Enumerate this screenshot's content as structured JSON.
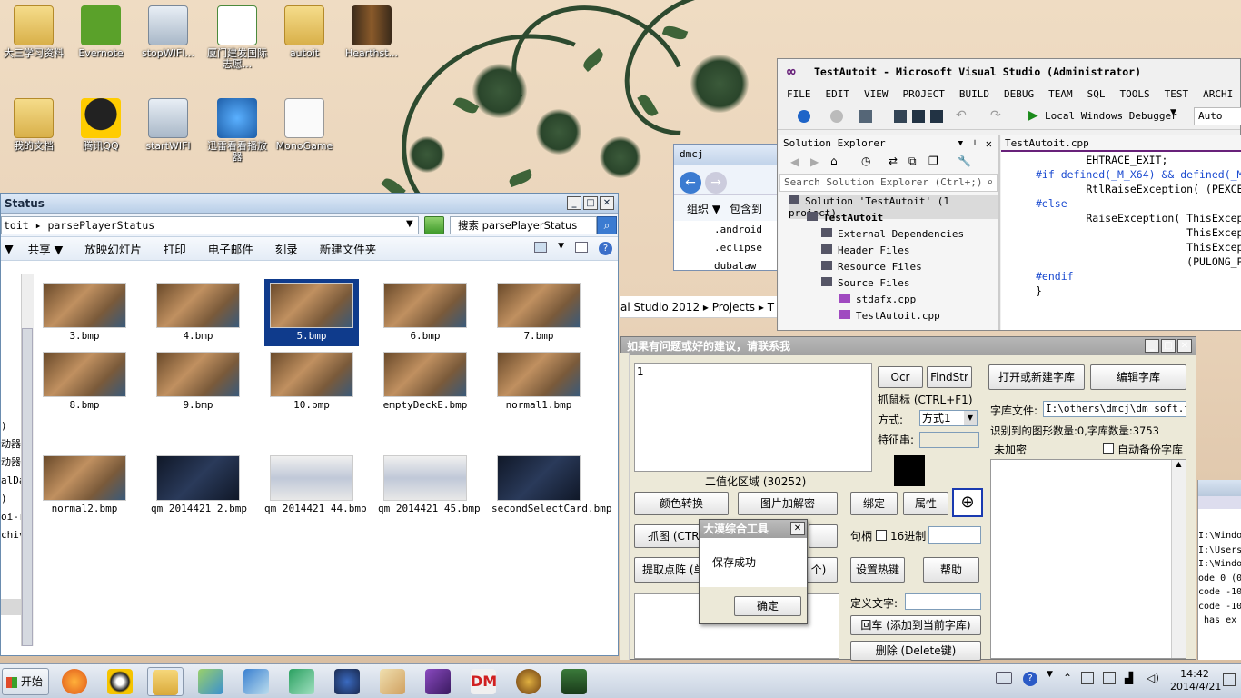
{
  "desktop": {
    "icons": [
      {
        "label": "大三学习资料",
        "kind": "folder"
      },
      {
        "label": "Evernote",
        "kind": "evernote"
      },
      {
        "label": "stopWIFI...",
        "kind": "wifi"
      },
      {
        "label": "厦门建发国际志愿...",
        "kind": "excel"
      },
      {
        "label": "autoit",
        "kind": "folder"
      },
      {
        "label": "Hearthst...",
        "kind": "hs"
      },
      {
        "label": "我的文档",
        "kind": "folder"
      },
      {
        "label": "腾讯QQ",
        "kind": "qq"
      },
      {
        "label": "startWIFI",
        "kind": "wifi"
      },
      {
        "label": "迅雷看看播放器",
        "kind": "player"
      },
      {
        "label": "MonoGame",
        "kind": "doc"
      }
    ]
  },
  "explorer": {
    "title": "Status",
    "address": "toit ▸ parsePlayerStatus",
    "search_placeholder": "搜索 parsePlayerStatus",
    "toolbar": [
      "共享 ▼",
      "放映幻灯片",
      "打印",
      "电子邮件",
      "刻录",
      "新建文件夹"
    ],
    "files": [
      {
        "name": "3.bmp",
        "style": "hs"
      },
      {
        "name": "4.bmp",
        "style": "hs"
      },
      {
        "name": "5.bmp",
        "style": "hs",
        "selected": true
      },
      {
        "name": "6.bmp",
        "style": "hs"
      },
      {
        "name": "7.bmp",
        "style": "hs"
      },
      {
        "name": "8.bmp",
        "style": "hs"
      },
      {
        "name": "9.bmp",
        "style": "hs"
      },
      {
        "name": "10.bmp",
        "style": "hs"
      },
      {
        "name": "emptyDeckE.bmp",
        "style": "hs"
      },
      {
        "name": "normal1.bmp",
        "style": "hs"
      },
      {
        "name": "normal2.bmp",
        "style": "hs"
      },
      {
        "name": "qm_2014421_2.bmp",
        "style": "dark"
      },
      {
        "name": "qm_2014421_44.bmp",
        "style": "white"
      },
      {
        "name": "qm_2014421_45.bmp",
        "style": "white"
      },
      {
        "name": "secondSelectCard.bmp",
        "style": "dark"
      }
    ],
    "left_fragments": [
      ")",
      "动器",
      "动器",
      "alDa",
      ")",
      "oi-r",
      "chiv"
    ]
  },
  "dmcj": {
    "title": "dmcj",
    "toolbar": [
      "组织 ▼",
      "包含到"
    ],
    "items": [
      ".android",
      ".eclipse",
      "dubalaw"
    ]
  },
  "vs": {
    "title": "TestAutoit - Microsoft Visual Studio (Administrator)",
    "menu": [
      "FILE",
      "EDIT",
      "VIEW",
      "PROJECT",
      "BUILD",
      "DEBUG",
      "TEAM",
      "SQL",
      "TOOLS",
      "TEST",
      "ARCHI"
    ],
    "debugger": "Local Windows Debugger",
    "config": "Auto",
    "solution_explorer": {
      "title": "Solution Explorer",
      "search": "Search Solution Explorer (Ctrl+;)",
      "items": [
        "Solution 'TestAutoit' (1 project)",
        "TestAutoit",
        "External Dependencies",
        "Header Files",
        "Resource Files",
        "Source Files",
        "stdafx.cpp",
        "TestAutoit.cpp"
      ]
    },
    "editor_tab": "TestAutoit.cpp",
    "code_lines": [
      "        EHTRACE_EXIT;",
      "#if defined(_M_X64) && defined(_M",
      "        RtlRaiseException( (PEXCE",
      "#else",
      "        RaiseException( ThisExcep",
      "                        ThisExcep",
      "                        ThisExcep",
      "                        (PULONG_P",
      "#endif",
      "}"
    ],
    "breadcrumb": "al Studio 2012 ▸ Projects ▸ T"
  },
  "dm": {
    "title": "如果有问题或好的建议，请联系我",
    "ocr": "Ocr",
    "findstr": "FindStr",
    "open_lib": "打开或新建字库",
    "edit_lib": "编辑字库",
    "capture_hint": "抓鼠标 (CTRL+F1)",
    "mode_label": "方式:",
    "mode_value": "方式1",
    "feature_label": "特征串:",
    "lib_file_label": "字库文件:",
    "lib_file_value": "I:\\others\\dmcj\\dm_soft.txt",
    "stats": "识别到的图形数量:0,字库数量:3753",
    "encrypt": "未加密",
    "auto_backup": "自动备份字库",
    "text_area": "1",
    "binary_area": "二值化区域 (30252)",
    "color_convert": "颜色转换",
    "image_decrypt": "图片加解密",
    "bind": "绑定",
    "property": "属性",
    "capture": "抓图 (CTRL+",
    "extract": "提取点阵 (单",
    "extract_tail": "个)",
    "handle_label": "句柄",
    "hex_label": "16进制",
    "hotkey": "设置热键",
    "help": "帮助",
    "define_text": "定义文字:",
    "enter_add": "回车 (添加到当前字库)",
    "delete": "删除 (Delete键)"
  },
  "dialog": {
    "title": "大漠综合工具",
    "message": "保存成功",
    "ok": "确定"
  },
  "console": [
    "I:\\Windo",
    "I:\\Users",
    "I:\\Windo",
    "ode 0 (0x",
    "code -107",
    "code -107",
    " has ex"
  ],
  "taskbar": {
    "start": "开始",
    "apps": [
      "firefox",
      "qq",
      "explorer",
      "gallery",
      "feiq",
      "maxthon",
      "hearthstone-deck",
      "paint",
      "visual-studio",
      "dm",
      "hearthstone",
      "terminal"
    ],
    "dm_label": "DM",
    "time": "14:42",
    "date": "2014/4/21"
  }
}
